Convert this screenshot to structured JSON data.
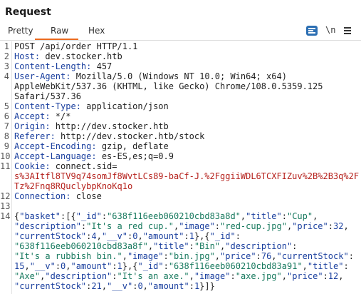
{
  "panel": {
    "title": "Request"
  },
  "tabs": [
    {
      "label": "Pretty"
    },
    {
      "label": "Raw"
    },
    {
      "label": "Hex"
    }
  ],
  "toolbar": {
    "newline_label": "\\n"
  },
  "request": {
    "request_line": "POST /api/order HTTP/1.1",
    "headers": [
      {
        "name": "Host",
        "value": "dev.stocker.htb"
      },
      {
        "name": "Content-Length",
        "value": "457"
      },
      {
        "name": "User-Agent",
        "value": "Mozilla/5.0 (Windows NT 10.0; Win64; x64)"
      },
      {
        "name": "",
        "value": "AppleWebKit/537.36 (KHTML, like Gecko) Chrome/108.0.5359.125"
      },
      {
        "name": "",
        "value": "Safari/537.36"
      },
      {
        "name": "Content-Type",
        "value": "application/json"
      },
      {
        "name": "Accept",
        "value": "*/*"
      },
      {
        "name": "Origin",
        "value": "http://dev.stocker.htb"
      },
      {
        "name": "Referer",
        "value": "http://dev.stocker.htb/stock"
      },
      {
        "name": "Accept-Encoding",
        "value": "gzip, deflate"
      },
      {
        "name": "Accept-Language",
        "value": "es-ES,es;q=0.9"
      },
      {
        "name": "Cookie",
        "value": "connect.sid="
      }
    ],
    "cookie_lines": [
      "s%3AItfl8TV9q74somJf8WvtLCs89-baCf-J.%2FggiiWDL6TCXFIZuv%2B%2B3q%2F",
      "Tz%2Fnq8RQuclybpKnoKq1o"
    ],
    "connection": {
      "name": "Connection",
      "value": "close"
    },
    "line_numbers": [
      "1",
      "2",
      "3",
      "4",
      "",
      "",
      "5",
      "6",
      "7",
      "8",
      "9",
      "10",
      "11",
      "",
      "",
      "12",
      "13",
      "14"
    ],
    "body_lines": [
      "{\"basket\":[{\"_id\":\"638f116eeb060210cbd83a8d\",\"title\":\"Cup\",",
      "\"description\":\"It's a red cup.\",\"image\":\"red-cup.jpg\",\"price\":32,",
      "\"currentStock\":4,\"__v\":0,\"amount\":1},{\"_id\":",
      "\"638f116eeb060210cbd83a8f\",\"title\":\"Bin\",\"description\":",
      "\"It's a rubbish bin.\",\"image\":\"bin.jpg\",\"price\":76,\"currentStock\":",
      "15,\"__v\":0,\"amount\":1},{\"_id\":\"638f116eeb060210cbd83a91\",\"title\":",
      "\"Axe\",\"description\":\"It's an axe.\",\"image\":\"axe.jpg\",\"price\":12,",
      "\"currentStock\":21,\"__v\":0,\"amount\":1}]}"
    ]
  },
  "colors": {
    "accent_tab": "#ea6a1f",
    "header_name": "#1a3f9e",
    "cookie_value": "#b5201b",
    "json_string": "#17795e",
    "wrap_button": "#2c6fb3"
  }
}
